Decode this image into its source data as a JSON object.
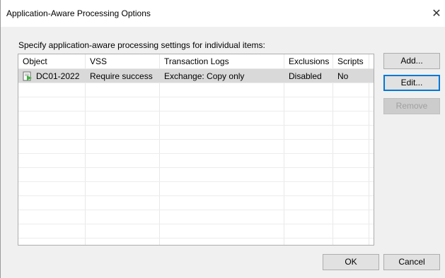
{
  "window": {
    "title": "Application-Aware Processing Options",
    "close_glyph": "✕"
  },
  "instruction": "Specify application-aware processing settings for individual items:",
  "table": {
    "columns": [
      "Object",
      "VSS",
      "Transaction Logs",
      "Exclusions",
      "Scripts"
    ],
    "rows": [
      {
        "icon": "vm-icon",
        "object": "DC01-2022",
        "vss": "Require success",
        "transaction_logs": "Exchange: Copy only",
        "exclusions": "Disabled",
        "scripts": "No",
        "selected": true
      }
    ]
  },
  "buttons": {
    "add": "Add...",
    "edit": "Edit...",
    "remove": "Remove",
    "ok": "OK",
    "cancel": "Cancel"
  },
  "colors": {
    "accent": "#0078d7",
    "selection": "#d9d9d9",
    "vm_icon_green": "#3bb33b"
  }
}
